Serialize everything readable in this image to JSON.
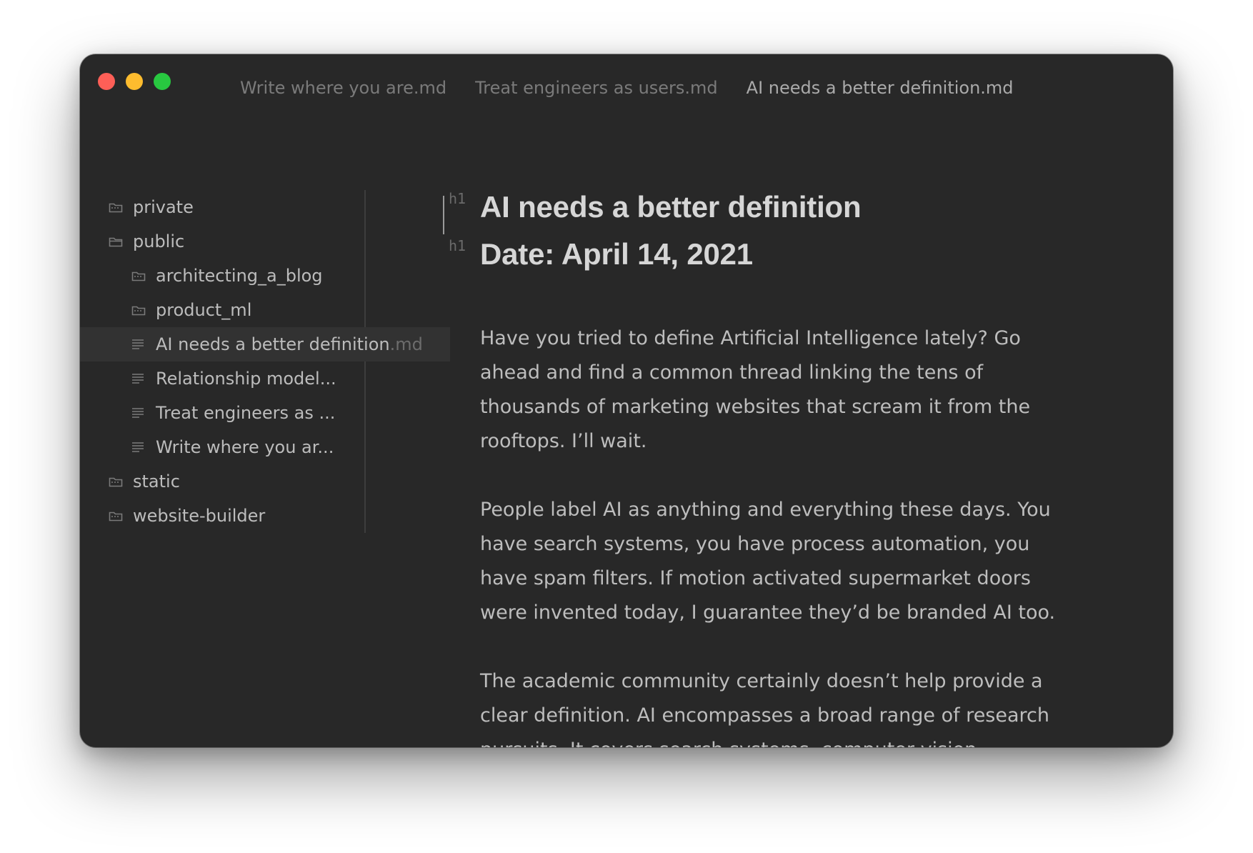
{
  "window": {
    "traffic_lights": {
      "close_color": "#fe5f57",
      "minimize_color": "#febc2e",
      "zoom_color": "#28c840"
    },
    "tabs": [
      {
        "label": "Write where you are.md",
        "active": false
      },
      {
        "label": "Treat engineers as users.md",
        "active": false
      },
      {
        "label": "AI needs a better definition.md",
        "active": true
      }
    ]
  },
  "sidebar": {
    "items": [
      {
        "label": "private",
        "type": "folder",
        "level": 0
      },
      {
        "label": "public",
        "type": "folder-open",
        "level": 0
      },
      {
        "label": "architecting_a_blog",
        "type": "folder",
        "level": 1
      },
      {
        "label": "product_ml",
        "type": "folder",
        "level": 1
      },
      {
        "label": "AI needs a better definition",
        "ext": ".md",
        "type": "file",
        "level": 1,
        "selected": true
      },
      {
        "label": "Relationship model...",
        "type": "file",
        "level": 1
      },
      {
        "label": "Treat engineers as ...",
        "type": "file",
        "level": 1
      },
      {
        "label": "Write where you ar...",
        "type": "file",
        "level": 1
      },
      {
        "label": "static",
        "type": "folder",
        "level": 0
      },
      {
        "label": "website-builder",
        "type": "folder",
        "level": 0
      }
    ]
  },
  "editor": {
    "headings": [
      {
        "marker": "h1",
        "text": "AI needs a better definition"
      },
      {
        "marker": "h1",
        "text": "Date: April 14, 2021"
      }
    ],
    "paragraphs": [
      "Have you tried to define Artificial Intelligence lately? Go ahead and find a common thread linking the tens of thousands of marketing websites that scream it from the rooftops. I’ll wait.",
      "People label AI as anything and everything these days. You have search systems, you have process automation, you have spam filters. If motion activated supermarket doors were invented today, I guarantee they’d be branded AI too.",
      "The academic community certainly doesn’t help provide a clear definition. AI encompasses a broad range of research pursuits. It covers search systems, computer vision,"
    ]
  }
}
